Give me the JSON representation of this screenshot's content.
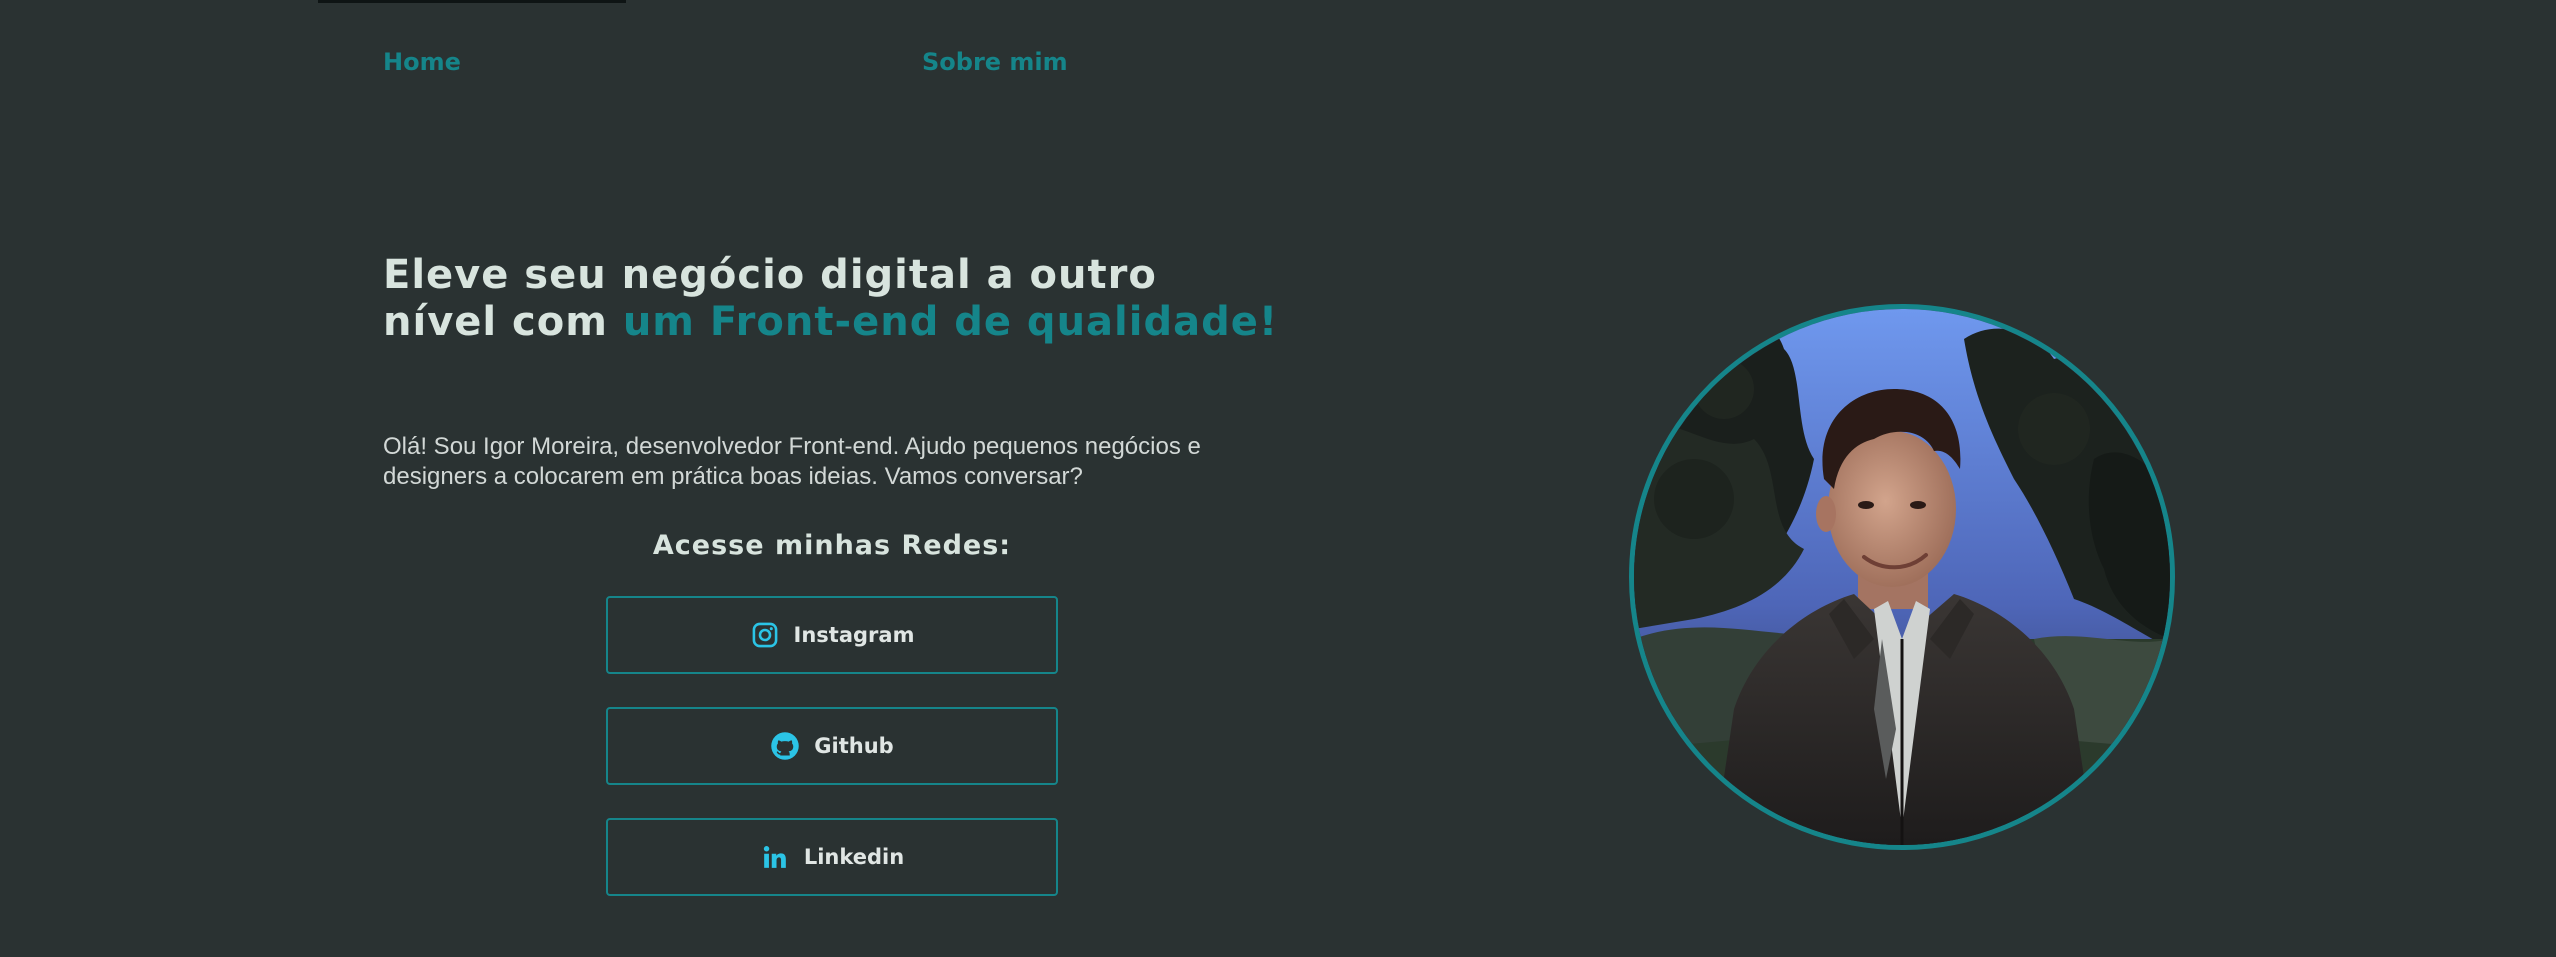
{
  "nav": {
    "home": "Home",
    "about": "Sobre mim"
  },
  "hero": {
    "title_plain": "Eleve seu negócio digital a outro nível com ",
    "title_accent": "um Front-end de qualidade!",
    "description": "Olá! Sou Igor Moreira, desenvolvedor Front-end. Ajudo pequenos negócios e designers a colocarem em prática boas ideias. Vamos conversar?"
  },
  "socials": {
    "heading": "Acesse minhas Redes:",
    "items": [
      {
        "label": "Instagram",
        "icon": "instagram-icon"
      },
      {
        "label": "Github",
        "icon": "github-icon"
      },
      {
        "label": "Linkedin",
        "icon": "linkedin-icon"
      }
    ]
  },
  "colors": {
    "background": "#2a3232",
    "accent": "#15858a",
    "icon": "#2bc4e6",
    "text_light": "#d8e4de"
  }
}
